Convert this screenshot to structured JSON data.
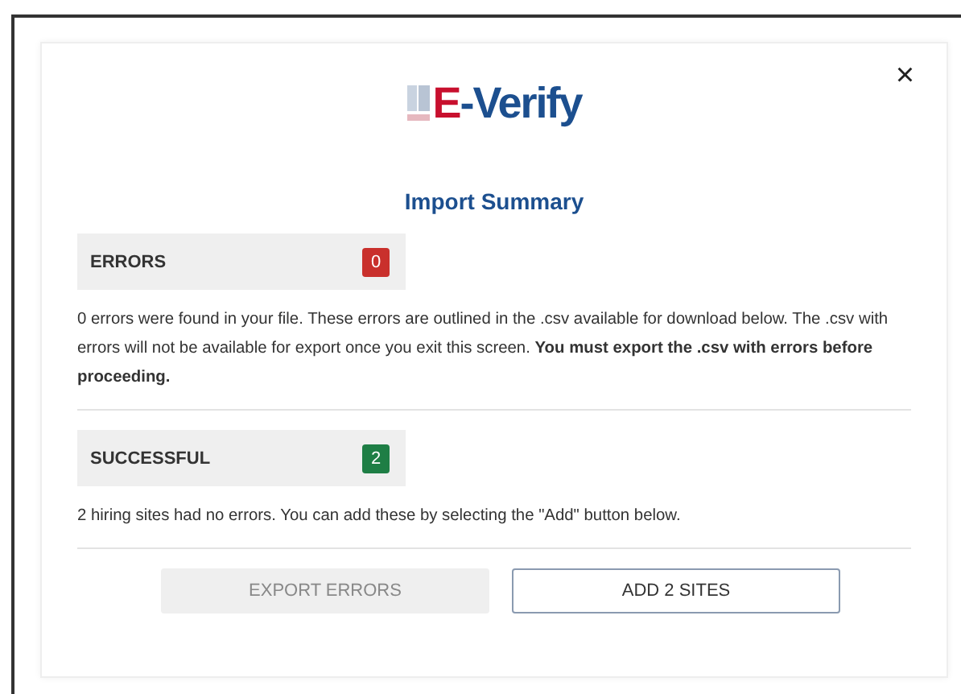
{
  "dialog": {
    "close": "×",
    "logo": {
      "mark": "E",
      "rest": "-Verify"
    },
    "title": "Import Summary"
  },
  "sections": [
    {
      "label": "ERRORS",
      "count": "0",
      "color": "#c9302c",
      "description": "0 errors were found in your file. These errors are outlined in the .csv available for download below. The .csv with errors will not be available for export once you exit this screen.  **You must export the .csv with errors before proceeding.**"
    },
    {
      "label": "SUCCESSFUL",
      "count": "2",
      "color": "#1e7e45",
      "description": "2 hiring sites had no errors. You can add these by selecting the \"Add\" button below."
    }
  ],
  "buttons": [
    {
      "label": "EXPORT ERRORS",
      "disabled": true
    },
    {
      "label": "ADD 2 SITES",
      "disabled": false
    }
  ]
}
